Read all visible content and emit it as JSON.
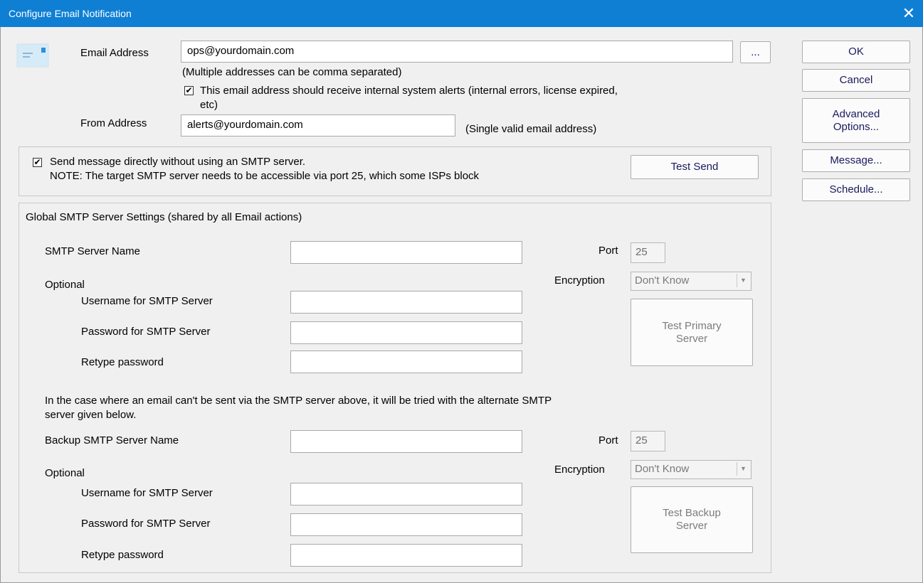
{
  "window": {
    "title": "Configure Email Notification",
    "close_glyph": "✕"
  },
  "email": {
    "label": "Email Address",
    "value": "ops@yourdomain.com",
    "browse_label": "...",
    "hint": "(Multiple addresses can be comma separated)",
    "alerts_checked": true,
    "alerts_text_line1": "This email address should receive internal system alerts (internal errors, license expired,",
    "alerts_text_line2": "etc)",
    "from_label": "From Address",
    "from_value": "alerts@yourdomain.com",
    "from_hint": "(Single valid email address)"
  },
  "direct": {
    "checked": true,
    "line1": "Send message directly without using an SMTP server.",
    "line2": "NOTE: The target SMTP server needs to be accessible via port 25, which some ISPs block",
    "test_send_label": "Test Send"
  },
  "smtp": {
    "group_title": "Global SMTP Server Settings (shared by all Email actions)",
    "primary": {
      "server_label": "SMTP Server Name",
      "server_value": "",
      "optional_label": "Optional",
      "username_label": "Username for SMTP Server",
      "password_label": "Password for SMTP Server",
      "retype_label": "Retype password",
      "port_label": "Port",
      "port_value": "25",
      "encryption_label": "Encryption",
      "encryption_value": "Don't Know",
      "test_line1": "Test Primary",
      "test_line2": "Server"
    },
    "backup_note_line1": "In the case where an email can't be sent via the SMTP server above, it will be tried with the alternate SMTP",
    "backup_note_line2": "server given below.",
    "backup": {
      "server_label": "Backup SMTP Server Name",
      "server_value": "",
      "optional_label": "Optional",
      "username_label": "Username for SMTP Server",
      "password_label": "Password for SMTP Server",
      "retype_label": "Retype password",
      "port_label": "Port",
      "port_value": "25",
      "encryption_label": "Encryption",
      "encryption_value": "Don't Know",
      "test_line1": "Test Backup",
      "test_line2": "Server"
    }
  },
  "side_buttons": {
    "ok": "OK",
    "cancel": "Cancel",
    "advanced_line1": "Advanced",
    "advanced_line2": "Options...",
    "message": "Message...",
    "schedule": "Schedule..."
  },
  "icons": {
    "email_icon": "envelope-icon",
    "dropdown_icon": "chevron-down-icon",
    "check": "✔"
  },
  "colors": {
    "titlebar": "#0f7fd4",
    "button_text": "#1a1a5e"
  }
}
